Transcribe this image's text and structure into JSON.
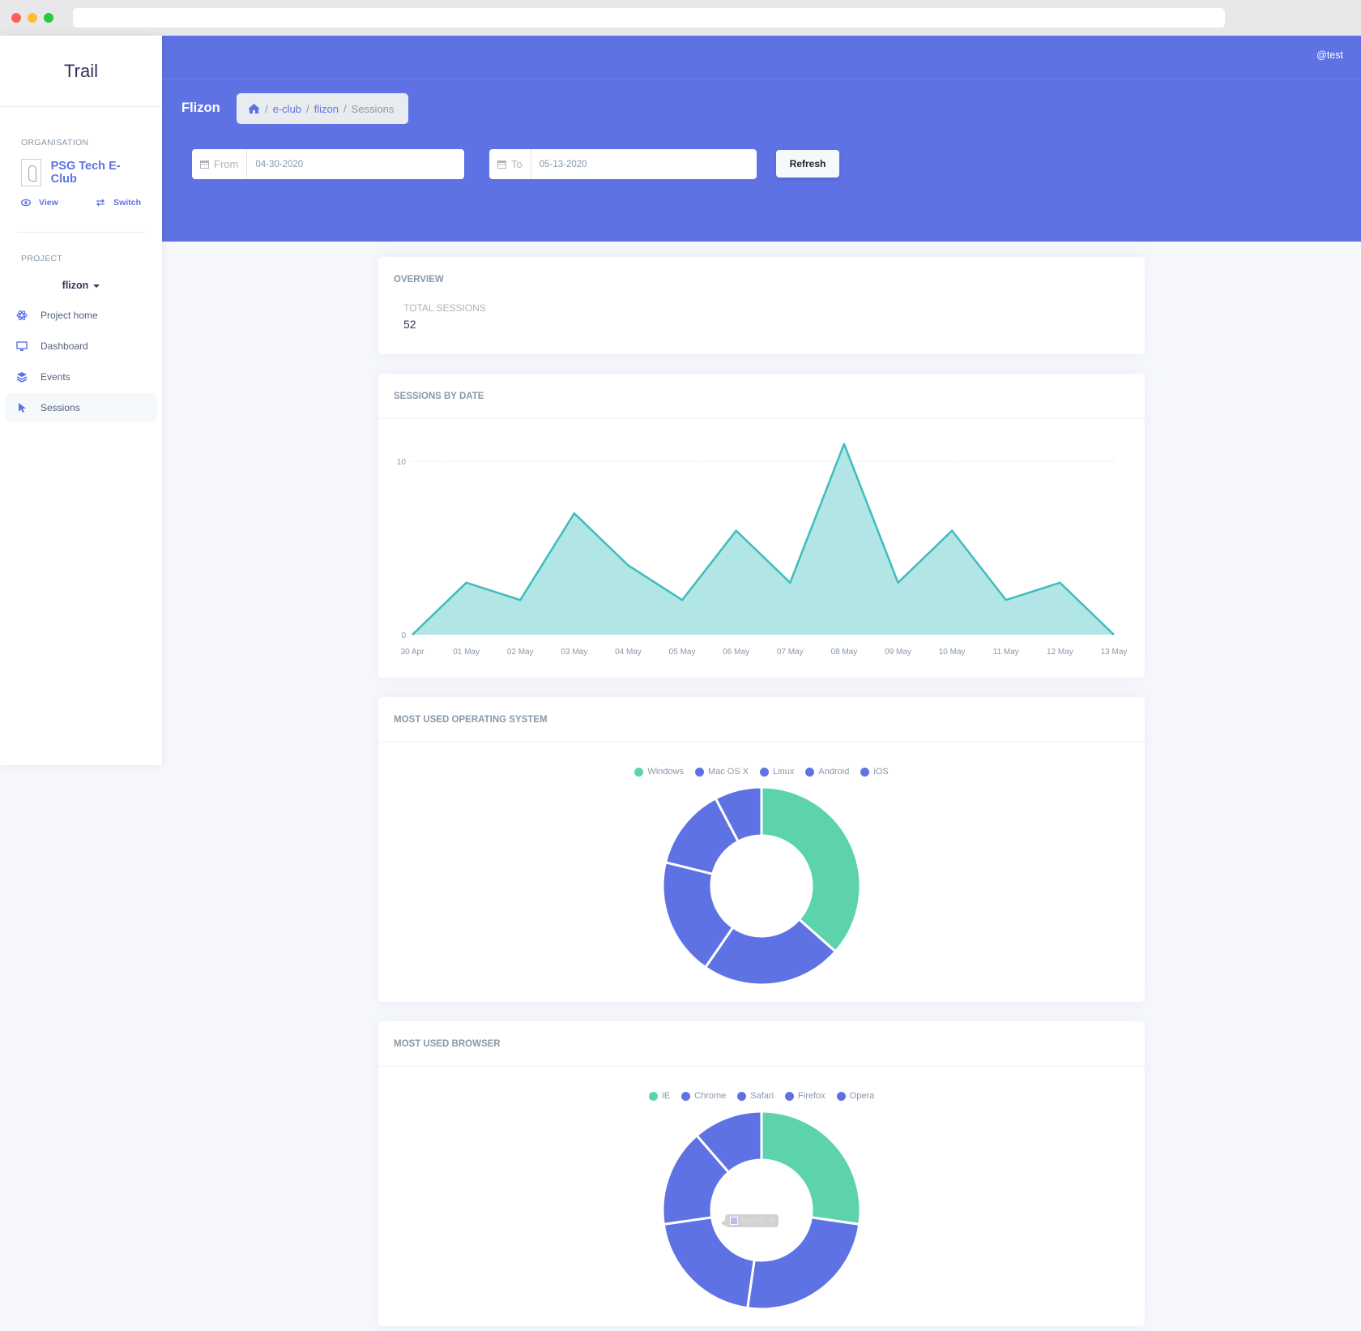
{
  "app": {
    "brand": "Trail",
    "user": "@test"
  },
  "sidebar": {
    "organisation_heading": "ORGANISATION",
    "organisation_name": "PSG Tech E-Club",
    "view_label": "View",
    "switch_label": "Switch",
    "project_heading": "PROJECT",
    "project_selected": "flizon",
    "items": [
      {
        "label": "Project home",
        "icon": "atom-icon",
        "active": false
      },
      {
        "label": "Dashboard",
        "icon": "monitor-icon",
        "active": false
      },
      {
        "label": "Events",
        "icon": "layers-icon",
        "active": false
      },
      {
        "label": "Sessions",
        "icon": "cursor-icon",
        "active": true
      }
    ]
  },
  "header": {
    "title": "Flizon",
    "breadcrumb": [
      "e-club",
      "flizon",
      "Sessions"
    ],
    "from_label": "From",
    "from_value": "04-30-2020",
    "to_label": "To",
    "to_value": "05-13-2020",
    "refresh_label": "Refresh"
  },
  "overview": {
    "title": "OVERVIEW",
    "total_label": "TOTAL SESSIONS",
    "total_value": "52"
  },
  "colors": {
    "primary": "#5e72e4",
    "teal_line": "#3fbcbc",
    "teal_fill": "#b2e5e5",
    "green": "#5cd3ad"
  },
  "chart_data": [
    {
      "type": "area",
      "title": "SESSIONS BY DATE",
      "categories": [
        "30 Apr",
        "01 May",
        "02 May",
        "03 May",
        "04 May",
        "05 May",
        "06 May",
        "07 May",
        "08 May",
        "09 May",
        "10 May",
        "11 May",
        "12 May",
        "13 May"
      ],
      "values": [
        0,
        3,
        2,
        7,
        4,
        2,
        6,
        3,
        11,
        3,
        6,
        2,
        3,
        0
      ],
      "yticks": [
        0,
        10
      ],
      "ylim": [
        0,
        11.5
      ],
      "grid": true
    },
    {
      "type": "pie",
      "title": "MOST USED OPERATING SYSTEM",
      "categories": [
        "Windows",
        "Mac OS X",
        "Linux",
        "Android",
        "iOS"
      ],
      "values": [
        19,
        12,
        10,
        7,
        4
      ],
      "colors": [
        "#5cd3ad",
        "#5e72e4",
        "#5e72e4",
        "#5e72e4",
        "#5e72e4"
      ],
      "legend": "top"
    },
    {
      "type": "pie",
      "title": "MOST USED BROWSER",
      "categories": [
        "IE",
        "Chrome",
        "Safari",
        "Firefox",
        "Opera"
      ],
      "values": [
        12,
        11,
        9,
        7,
        5
      ],
      "colors": [
        "#5cd3ad",
        "#5e72e4",
        "#5e72e4",
        "#5e72e4",
        "#5e72e4"
      ],
      "legend": "top",
      "tooltip": "Safari: 9"
    }
  ]
}
